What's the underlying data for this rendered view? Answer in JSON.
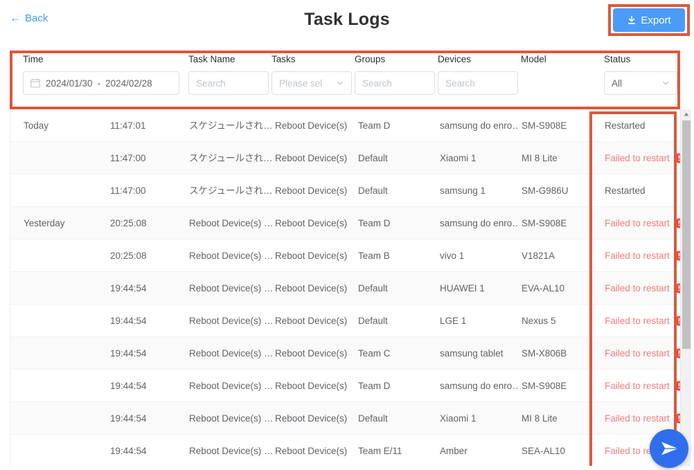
{
  "header": {
    "back_label": "Back",
    "back_icon": "arrow-left-icon",
    "title": "Task Logs",
    "export_label": "Export",
    "export_icon": "download-icon",
    "accent_blue": "#4a9cf6",
    "highlight_red": "#d9593d"
  },
  "filters": {
    "time": {
      "label": "Time",
      "icon": "calendar-icon",
      "start": "2024/01/30",
      "separator": "-",
      "end": "2024/02/28"
    },
    "task_name": {
      "label": "Task Name",
      "placeholder": "Search",
      "value": ""
    },
    "tasks": {
      "label": "Tasks",
      "placeholder": "Please sel",
      "value": "",
      "icon": "chevron-down-icon"
    },
    "groups": {
      "label": "Groups",
      "placeholder": "Search",
      "value": ""
    },
    "devices": {
      "label": "Devices",
      "placeholder": "Search",
      "value": ""
    },
    "model": {
      "label": "Model"
    },
    "status": {
      "label": "Status",
      "value": "All",
      "icon": "chevron-down-icon"
    }
  },
  "table": {
    "columns": [
      "Time",
      "Task Name",
      "Tasks",
      "Groups",
      "Devices",
      "Model",
      "Status"
    ],
    "rows": [
      {
        "day": "Today",
        "time": "11:47:01",
        "task_name": "スケジュールされ…",
        "tasks": "Reboot Device(s)",
        "group": "Team D",
        "device": "samsung do enro…",
        "model": "SM-S908E",
        "status": "Restarted",
        "failed": false
      },
      {
        "day": "",
        "time": "11:47:00",
        "task_name": "スケジュールされ…",
        "tasks": "Reboot Device(s)",
        "group": "Default",
        "device": "Xiaomi 1",
        "model": "MI 8 Lite",
        "status": "Failed to restart",
        "failed": true
      },
      {
        "day": "",
        "time": "11:47:00",
        "task_name": "スケジュールされ…",
        "tasks": "Reboot Device(s)",
        "group": "Default",
        "device": "samsung 1",
        "model": "SM-G986U",
        "status": "Restarted",
        "failed": false
      },
      {
        "day": "Yesterday",
        "time": "20:25:08",
        "task_name": "Reboot Device(s) …",
        "tasks": "Reboot Device(s)",
        "group": "Team D",
        "device": "samsung do enro…",
        "model": "SM-S908E",
        "status": "Failed to restart",
        "failed": true
      },
      {
        "day": "",
        "time": "20:25:08",
        "task_name": "Reboot Device(s) …",
        "tasks": "Reboot Device(s)",
        "group": "Team B",
        "device": "vivo 1",
        "model": "V1821A",
        "status": "Failed to restart",
        "failed": true
      },
      {
        "day": "",
        "time": "19:44:54",
        "task_name": "Reboot Device(s) …",
        "tasks": "Reboot Device(s)",
        "group": "Default",
        "device": "HUAWEI 1",
        "model": "EVA-AL10",
        "status": "Failed to restart",
        "failed": true
      },
      {
        "day": "",
        "time": "19:44:54",
        "task_name": "Reboot Device(s) …",
        "tasks": "Reboot Device(s)",
        "group": "Default",
        "device": "LGE 1",
        "model": "Nexus 5",
        "status": "Failed to restart",
        "failed": true
      },
      {
        "day": "",
        "time": "19:44:54",
        "task_name": "Reboot Device(s) …",
        "tasks": "Reboot Device(s)",
        "group": "Team C",
        "device": "samsung tablet",
        "model": "SM-X806B",
        "status": "Failed to restart",
        "failed": true
      },
      {
        "day": "",
        "time": "19:44:54",
        "task_name": "Reboot Device(s) …",
        "tasks": "Reboot Device(s)",
        "group": "Team D",
        "device": "samsung do enro…",
        "model": "SM-S908E",
        "status": "Failed to restart",
        "failed": true
      },
      {
        "day": "",
        "time": "19:44:54",
        "task_name": "Reboot Device(s) …",
        "tasks": "Reboot Device(s)",
        "group": "Default",
        "device": "Xiaomi 1",
        "model": "MI 8 Lite",
        "status": "Failed to restart",
        "failed": true
      },
      {
        "day": "",
        "time": "19:44:54",
        "task_name": "Reboot Device(s) …",
        "tasks": "Reboot Device(s)",
        "group": "Team E/11",
        "device": "Amber",
        "model": "SEA-AL10",
        "status": "Failed to restart",
        "failed": true
      }
    ]
  },
  "scrollbar": {
    "up_icon": "caret-up-icon"
  },
  "fab": {
    "icon": "send-icon",
    "color": "#2f6fed"
  }
}
